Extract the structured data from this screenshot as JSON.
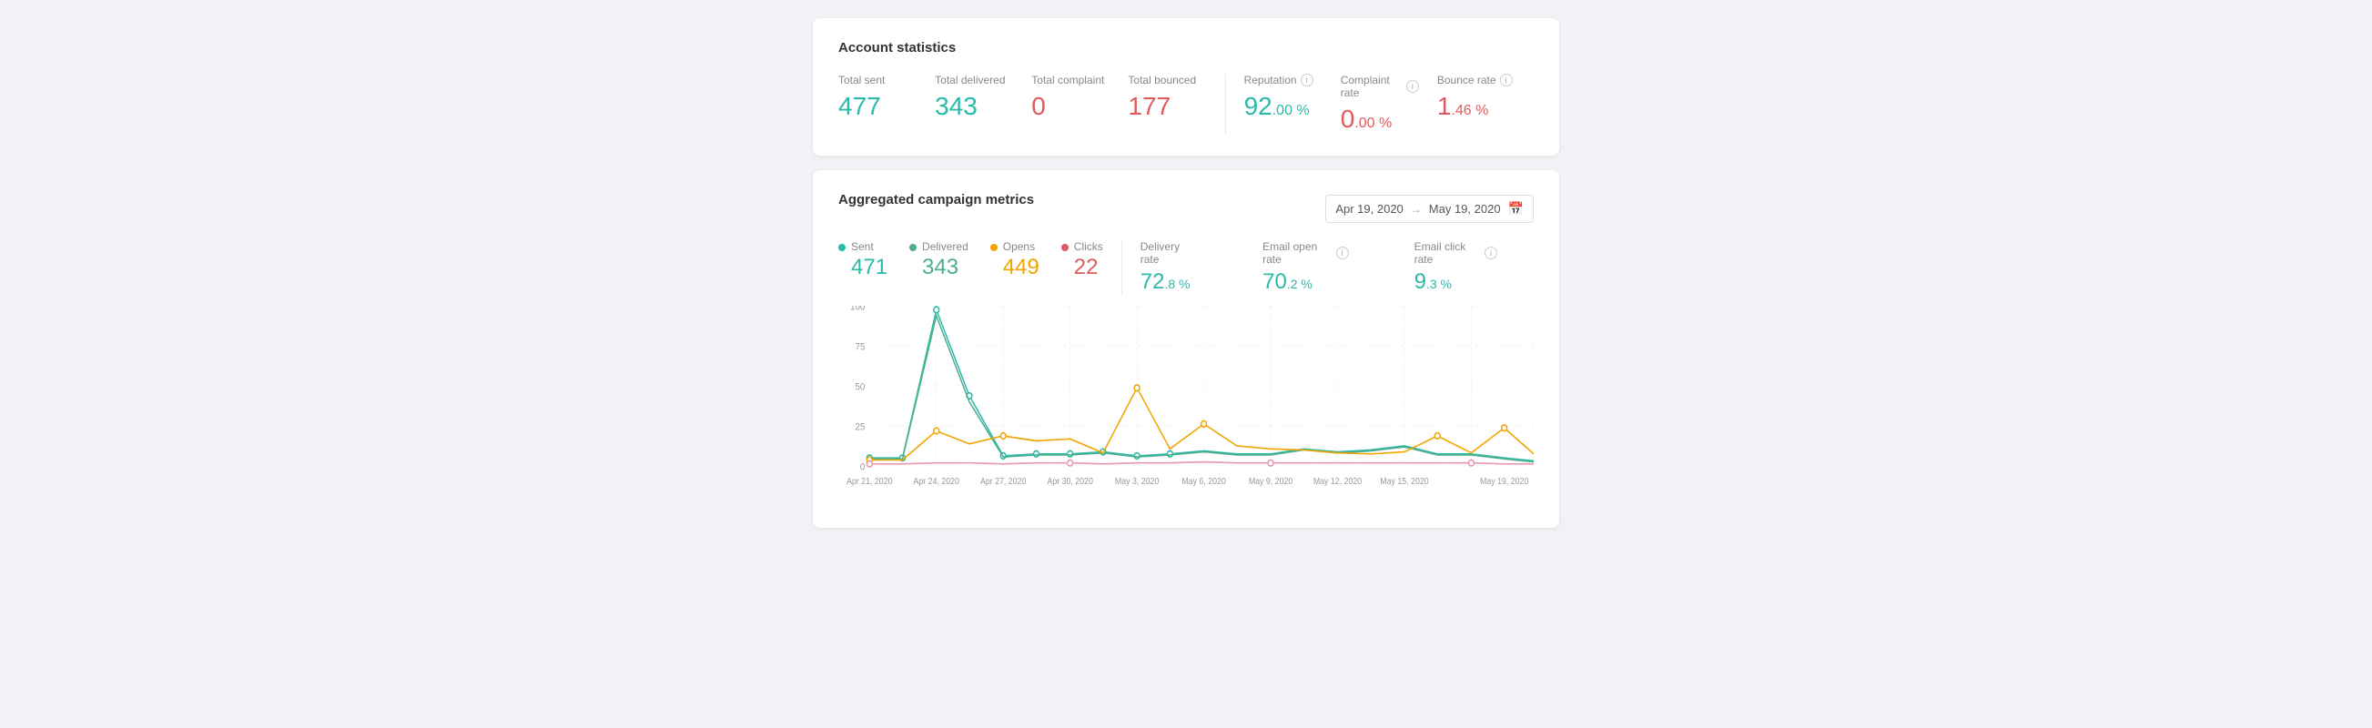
{
  "account_statistics": {
    "title": "Account statistics",
    "stats": [
      {
        "id": "total-sent",
        "label": "Total sent",
        "value": "477",
        "color": "teal",
        "small": "",
        "has_info": false
      },
      {
        "id": "total-delivered",
        "label": "Total delivered",
        "value": "343",
        "color": "teal",
        "small": "",
        "has_info": false
      },
      {
        "id": "total-complaint",
        "label": "Total complaint",
        "value": "0",
        "color": "red",
        "small": "",
        "has_info": false
      },
      {
        "id": "total-bounced",
        "label": "Total bounced",
        "value": "177",
        "color": "red",
        "small": "",
        "has_info": false
      }
    ],
    "rates": [
      {
        "id": "reputation",
        "label": "Reputation",
        "value": "92",
        "small": ".00 %",
        "color": "teal",
        "has_info": true
      },
      {
        "id": "complaint-rate",
        "label": "Complaint rate",
        "value": "0",
        "small": ".00 %",
        "color": "red",
        "has_info": true
      },
      {
        "id": "bounce-rate",
        "label": "Bounce rate",
        "value": "1",
        "small": ".46 %",
        "color": "red",
        "has_info": true
      }
    ]
  },
  "campaign_metrics": {
    "title": "Aggregated campaign metrics",
    "date_from": "Apr 19, 2020",
    "date_to": "May 19, 2020",
    "legend": [
      {
        "id": "sent",
        "label": "Sent",
        "value": "471",
        "color": "#2abaaa",
        "text_color": "#2abaaa"
      },
      {
        "id": "delivered",
        "label": "Delivered",
        "value": "343",
        "color": "#4caf89",
        "text_color": "#4caf89"
      },
      {
        "id": "opens",
        "label": "Opens",
        "value": "449",
        "color": "#f0a500",
        "text_color": "#f0a500"
      },
      {
        "id": "clicks",
        "label": "Clicks",
        "value": "22",
        "color": "#e05c5c",
        "text_color": "#e05c5c"
      }
    ],
    "rates": [
      {
        "id": "delivery-rate",
        "label": "Delivery rate",
        "value": "72",
        "small": ".8 %",
        "color": "#2abaaa",
        "has_info": false
      },
      {
        "id": "email-open-rate",
        "label": "Email open rate",
        "value": "70",
        "small": ".2 %",
        "color": "#2abaaa",
        "has_info": true
      },
      {
        "id": "email-click-rate",
        "label": "Email click rate",
        "value": "9",
        "small": ".3 %",
        "color": "#2abaaa",
        "has_info": true
      }
    ],
    "chart": {
      "y_labels": [
        "100",
        "75",
        "50",
        "25",
        "0"
      ],
      "x_labels": [
        "Apr 21, 2020",
        "Apr 24, 2020",
        "Apr 27, 2020",
        "Apr 30, 2020",
        "May 3, 2020",
        "May 6, 2020",
        "May 9, 2020",
        "May 12, 2020",
        "May 15, 2020",
        "May 19, 2020"
      ]
    }
  }
}
